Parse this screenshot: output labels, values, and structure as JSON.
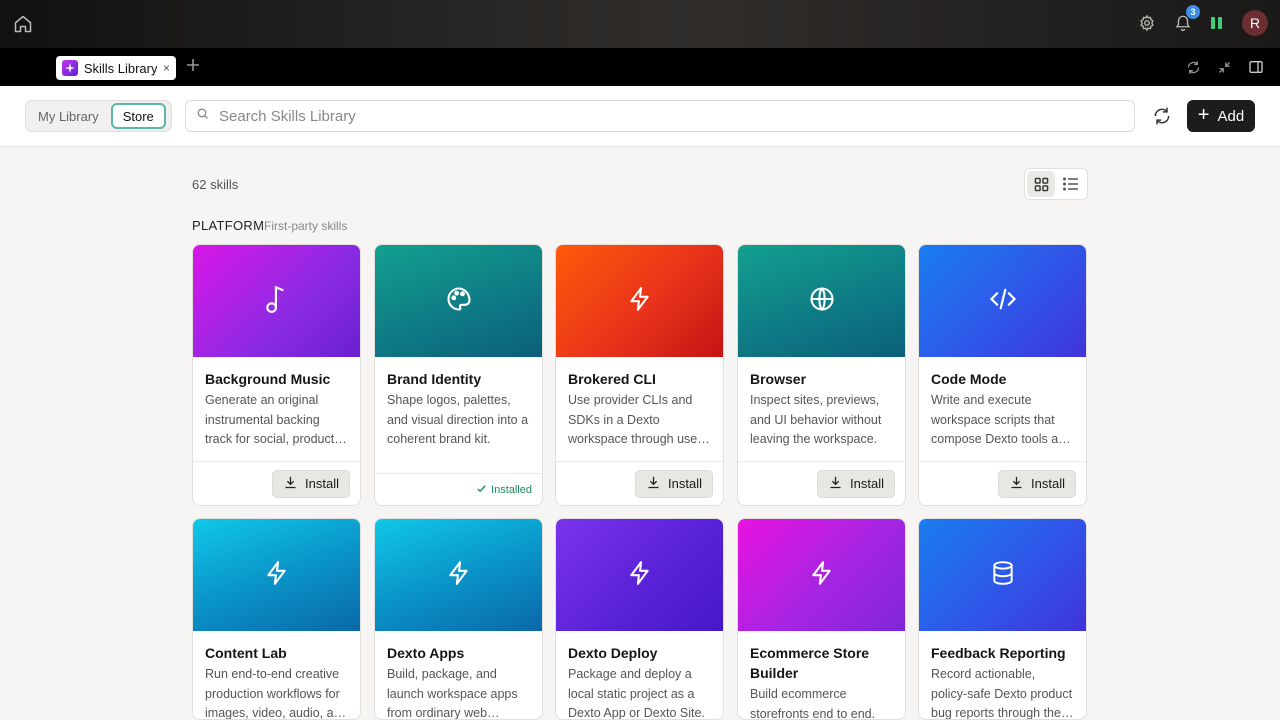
{
  "topbar": {
    "notification_count": "3",
    "avatar_initial": "R"
  },
  "tabs": [
    {
      "title": "Skills Library",
      "close": "×"
    }
  ],
  "toolbar": {
    "segments": [
      "My Library",
      "Store"
    ],
    "active_segment": "Store",
    "search_placeholder": "Search Skills Library",
    "add_label": "Add"
  },
  "content": {
    "count": "62 skills",
    "section": {
      "title": "PLATFORM",
      "subtitle": "First-party skills"
    },
    "cards": [
      {
        "name": "Background Music",
        "desc": "Generate an original instrumental backing track for social, product, and video content.",
        "icon": "music-note-icon",
        "action": "Install",
        "installed": false
      },
      {
        "name": "Brand Identity",
        "desc": "Shape logos, palettes, and visual direction into a coherent brand kit.",
        "icon": "palette-icon",
        "action": "Installed",
        "installed": true
      },
      {
        "name": "Brokered CLI",
        "desc": "Use provider CLIs and SDKs in a Dexto workspace through user-approved credentials.",
        "icon": "lightning-icon",
        "action": "Install",
        "installed": false
      },
      {
        "name": "Browser",
        "desc": "Inspect sites, previews, and UI behavior without leaving the workspace.",
        "icon": "globe-icon",
        "action": "Install",
        "installed": false
      },
      {
        "name": "Code Mode",
        "desc": "Write and execute workspace scripts that compose Dexto tools and APIs.",
        "icon": "code-icon",
        "action": "Install",
        "installed": false
      },
      {
        "name": "Content Lab",
        "desc": "Run end-to-end creative production workflows for images, video, audio, and more.",
        "icon": "lightning-icon"
      },
      {
        "name": "Dexto Apps",
        "desc": "Build, package, and launch workspace apps from ordinary web projects.",
        "icon": "lightning-icon"
      },
      {
        "name": "Dexto Deploy",
        "desc": "Package and deploy a local static project as a Dexto App or Dexto Site.",
        "icon": "lightning-icon"
      },
      {
        "name": "Ecommerce Store Builder",
        "desc": "Build ecommerce storefronts end to end.",
        "icon": "lightning-icon"
      },
      {
        "name": "Feedback Reporting",
        "desc": "Record actionable, policy-safe Dexto product bug reports through the feedback flow.",
        "icon": "database-icon"
      }
    ]
  }
}
